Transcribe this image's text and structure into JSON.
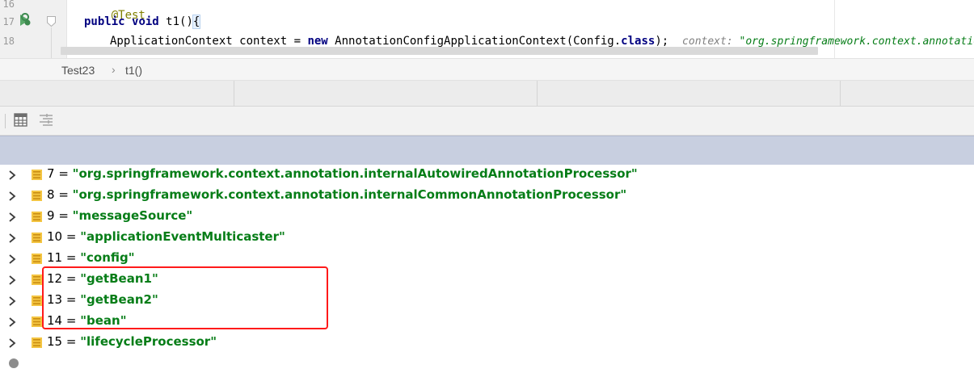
{
  "editor": {
    "line_numbers": [
      "16",
      "17",
      "18"
    ],
    "lines": {
      "annotation": "@Test",
      "method_decl_kw1": "public",
      "method_decl_kw2": "void",
      "method_name": " t1()",
      "method_brace": "{",
      "assign_type": "ApplicationContext context = ",
      "assign_new": "new",
      "assign_ctor": " AnnotationConfigApplicationContext(Config.",
      "assign_class_kw": "class",
      "assign_end": ");",
      "inline_hint_label": "context: ",
      "inline_hint_value": "\"org.springframework.context.annotation.A"
    },
    "icons": [
      "run-test-icon",
      "fold-icon"
    ]
  },
  "breadcrumb": {
    "class_name": "Test23",
    "separator": "›",
    "method_name": "t1()"
  },
  "toolbar": {
    "icons": [
      "table-view-icon",
      "list-view-icon"
    ]
  },
  "variables": {
    "rows": [
      {
        "index": "7",
        "value": "\"org.springframework.context.annotation.internalAutowiredAnnotationProcessor\""
      },
      {
        "index": "8",
        "value": "\"org.springframework.context.annotation.internalCommonAnnotationProcessor\""
      },
      {
        "index": "9",
        "value": "\"messageSource\""
      },
      {
        "index": "10",
        "value": "\"applicationEventMulticaster\""
      },
      {
        "index": "11",
        "value": "\"config\""
      },
      {
        "index": "12",
        "value": "\"getBean1\""
      },
      {
        "index": "13",
        "value": "\"getBean2\""
      },
      {
        "index": "14",
        "value": "\"bean\""
      },
      {
        "index": "15",
        "value": "\"lifecycleProcessor\""
      }
    ],
    "equals": " = ",
    "highlight_color": "#ff1a1a",
    "value_color": "#067d17"
  }
}
